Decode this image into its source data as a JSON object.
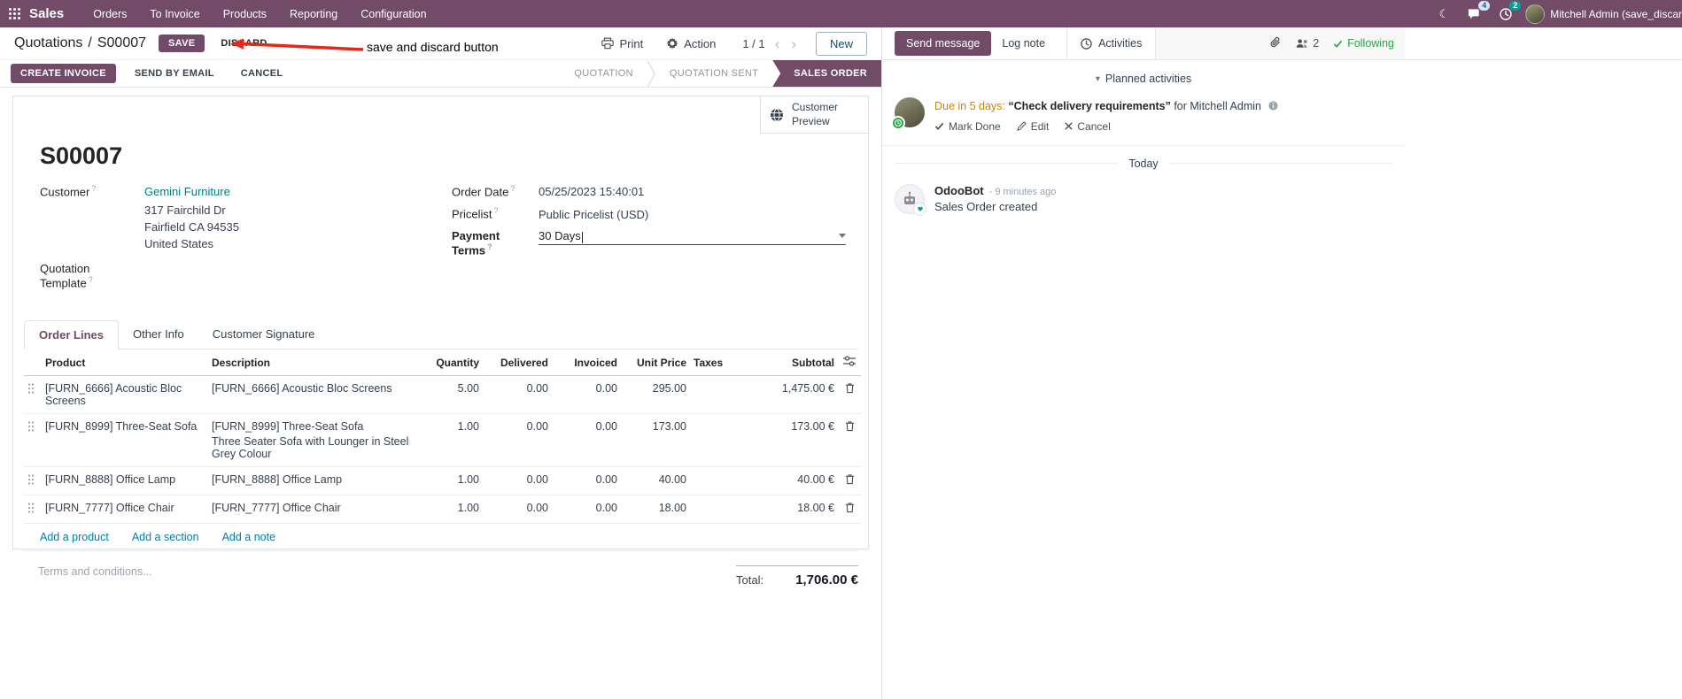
{
  "colors": {
    "brand_purple": "#714B67",
    "link_blue": "#017ea8",
    "customer_link_teal": "#017e84",
    "due_orange": "#cc8500",
    "following_green": "#28a745",
    "statusbar_active": "#714B67",
    "annotation_red": "#e3291d"
  },
  "icons": {
    "moon": "☾",
    "caret_down": "▾"
  },
  "topbar": {
    "app_name": "Sales",
    "menus": [
      "Orders",
      "To Invoice",
      "Products",
      "Reporting",
      "Configuration"
    ],
    "messages_badge": "4",
    "activities_badge": "2",
    "user_name": "Mitchell Admin (save_discar"
  },
  "control_panel": {
    "breadcrumb_parent": "Quotations",
    "breadcrumb_separator": "/",
    "breadcrumb_current": "S00007",
    "save_label": "SAVE",
    "discard_label": "DISCARD",
    "print_label": "Print",
    "action_label": "Action",
    "pager_value": "1 / 1",
    "pager_prev": "‹",
    "pager_next": "›",
    "new_label": "New"
  },
  "annotation": {
    "text": "save and discard button"
  },
  "statusbar": {
    "action_buttons": [
      "CREATE INVOICE",
      "SEND BY EMAIL",
      "CANCEL"
    ],
    "states": [
      "QUOTATION",
      "QUOTATION SENT",
      "SALES ORDER"
    ],
    "active_state": "SALES ORDER"
  },
  "form": {
    "customer_preview_label": "Customer Preview",
    "record_name": "S00007",
    "help_marker": "?",
    "left_fields": {
      "customer_label": "Customer",
      "customer_value": "Gemini Furniture",
      "address_line1": "317 Fairchild Dr",
      "address_line2": "Fairfield CA 94535",
      "address_line3": "United States",
      "quotation_template_label": "Quotation Template"
    },
    "right_fields": {
      "order_date_label": "Order Date",
      "order_date_value": "05/25/2023 15:40:01",
      "pricelist_label": "Pricelist",
      "pricelist_value": "Public Pricelist (USD)",
      "payment_terms_label": "Payment Terms",
      "payment_terms_value": "30 Days"
    },
    "tabs": [
      "Order Lines",
      "Other Info",
      "Customer Signature"
    ],
    "order_lines": {
      "columns": {
        "product": "Product",
        "description": "Description",
        "quantity": "Quantity",
        "delivered": "Delivered",
        "invoiced": "Invoiced",
        "unit_price": "Unit Price",
        "taxes": "Taxes",
        "subtotal": "Subtotal"
      },
      "rows": [
        {
          "product": "[FURN_6666] Acoustic Bloc Screens",
          "description": "[FURN_6666] Acoustic Bloc Screens",
          "description_extra": "",
          "quantity": "5.00",
          "delivered": "0.00",
          "invoiced": "0.00",
          "unit_price": "295.00",
          "taxes": "",
          "subtotal": "1,475.00 €"
        },
        {
          "product": "[FURN_8999] Three-Seat Sofa",
          "description": "[FURN_8999] Three-Seat Sofa",
          "description_extra": "Three Seater Sofa with Lounger in Steel Grey Colour",
          "quantity": "1.00",
          "delivered": "0.00",
          "invoiced": "0.00",
          "unit_price": "173.00",
          "taxes": "",
          "subtotal": "173.00 €"
        },
        {
          "product": "[FURN_8888] Office Lamp",
          "description": "[FURN_8888] Office Lamp",
          "description_extra": "",
          "quantity": "1.00",
          "delivered": "0.00",
          "invoiced": "0.00",
          "unit_price": "40.00",
          "taxes": "",
          "subtotal": "40.00 €"
        },
        {
          "product": "[FURN_7777] Office Chair",
          "description": "[FURN_7777] Office Chair",
          "description_extra": "",
          "quantity": "1.00",
          "delivered": "0.00",
          "invoiced": "0.00",
          "unit_price": "18.00",
          "taxes": "",
          "subtotal": "18.00 €"
        }
      ],
      "footer_links": [
        "Add a product",
        "Add a section",
        "Add a note"
      ]
    },
    "terms_placeholder": "Terms and conditions...",
    "total_label": "Total:",
    "total_value": "1,706.00 €"
  },
  "chatter": {
    "send_message_label": "Send message",
    "log_note_label": "Log note",
    "activities_tab_label": "Activities",
    "followers_count": "2",
    "following_label": "Following",
    "planned_activities_header": "Planned activities",
    "activity": {
      "due_text": "Due in 5 days:",
      "summary": "“Check delivery requirements”",
      "assignee_text": "for Mitchell Admin",
      "mark_done_label": "Mark Done",
      "edit_label": "Edit",
      "cancel_label": "Cancel"
    },
    "date_divider": "Today",
    "message": {
      "author": "OdooBot",
      "timestamp": "- 9 minutes ago",
      "body": "Sales Order created"
    }
  }
}
